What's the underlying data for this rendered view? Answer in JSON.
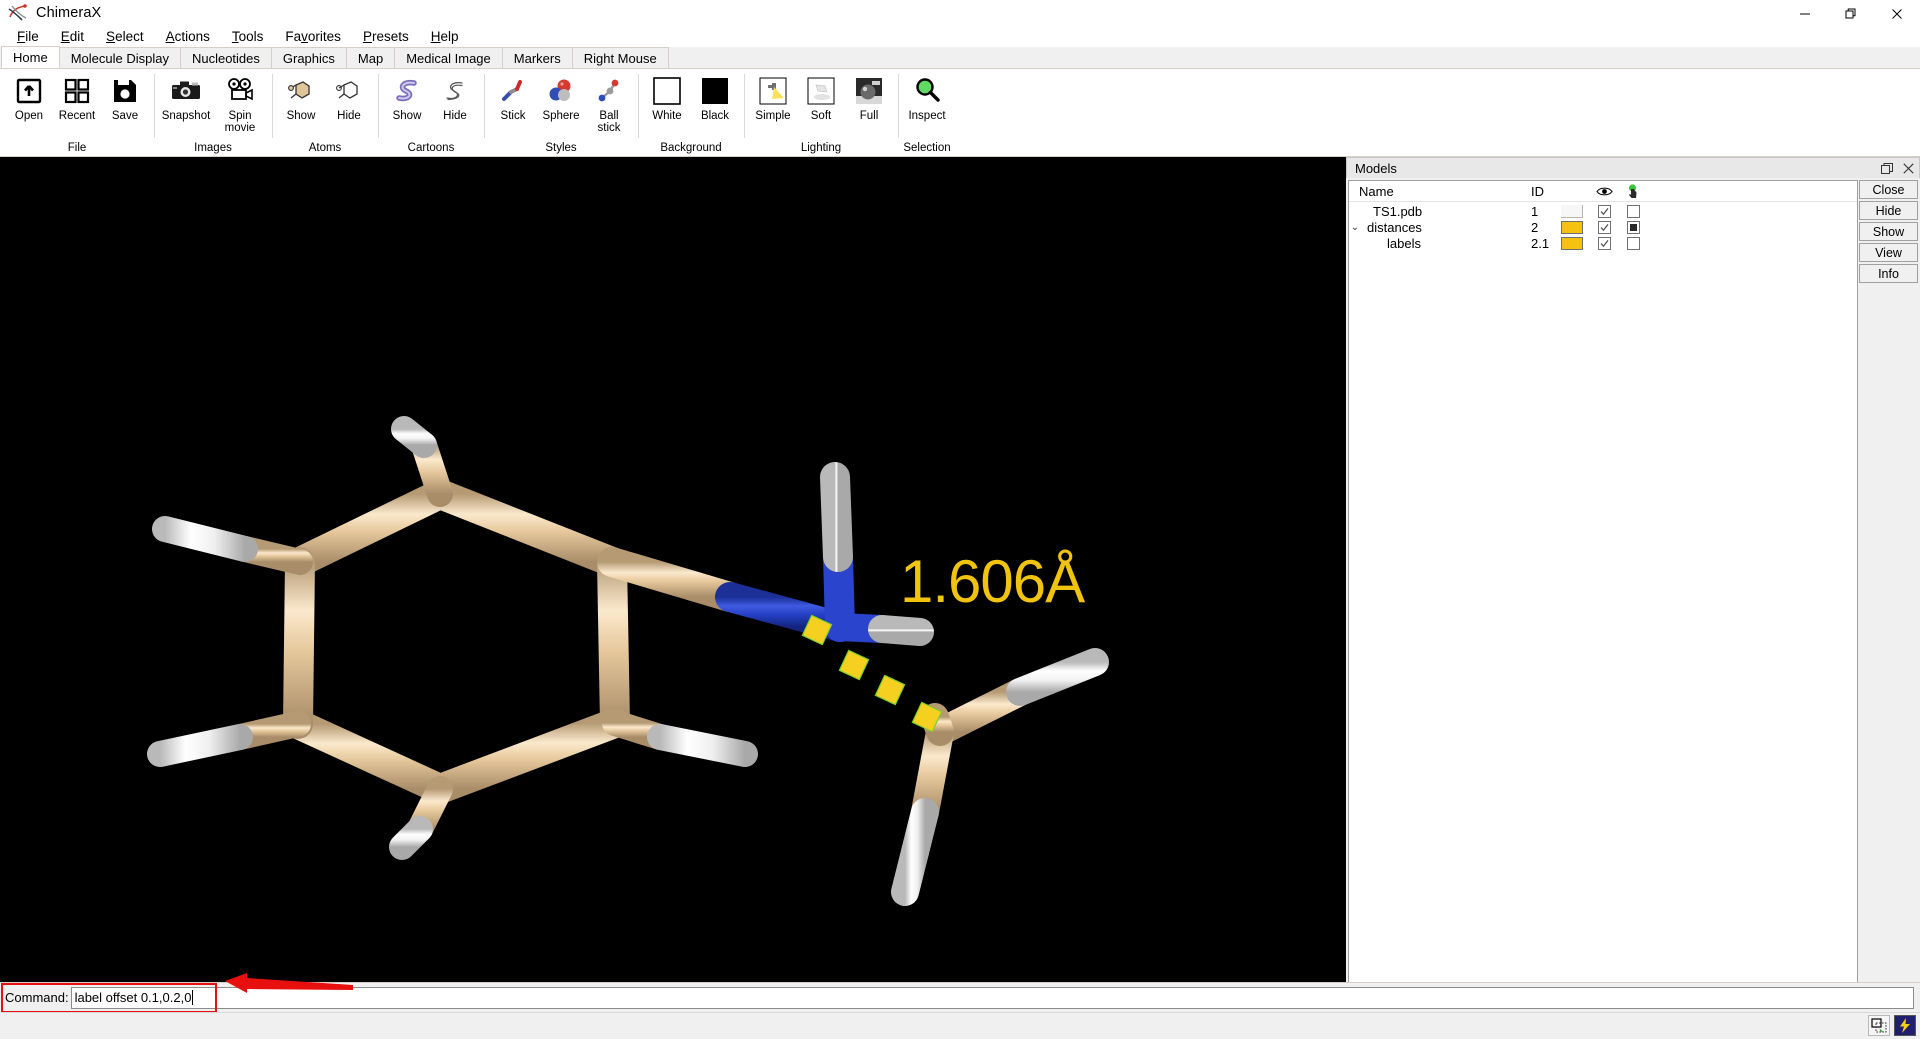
{
  "window": {
    "title": "ChimeraX",
    "app_icon": "chimerax-icon",
    "minimize": "–",
    "maximize": "❐",
    "close": "✕"
  },
  "menubar": {
    "items": [
      {
        "label": "File",
        "mnemonic": "F"
      },
      {
        "label": "Edit",
        "mnemonic": "E"
      },
      {
        "label": "Select",
        "mnemonic": "S"
      },
      {
        "label": "Actions",
        "mnemonic": "A"
      },
      {
        "label": "Tools",
        "mnemonic": "T"
      },
      {
        "label": "Favorites",
        "mnemonic": "v"
      },
      {
        "label": "Presets",
        "mnemonic": "P"
      },
      {
        "label": "Help",
        "mnemonic": "H"
      }
    ]
  },
  "tabs": [
    {
      "label": "Home",
      "active": true
    },
    {
      "label": "Molecule Display",
      "active": false
    },
    {
      "label": "Nucleotides",
      "active": false
    },
    {
      "label": "Graphics",
      "active": false
    },
    {
      "label": "Map",
      "active": false
    },
    {
      "label": "Medical Image",
      "active": false
    },
    {
      "label": "Markers",
      "active": false
    },
    {
      "label": "Right Mouse",
      "active": false
    }
  ],
  "ribbon": {
    "groups": [
      {
        "name": "File",
        "items": [
          {
            "label": "Open",
            "icon": "open-folder-icon"
          },
          {
            "label": "Recent",
            "icon": "recent-grid-icon"
          },
          {
            "label": "Save",
            "icon": "save-floppy-icon"
          }
        ]
      },
      {
        "name": "Images",
        "items": [
          {
            "label": "Snapshot",
            "icon": "camera-icon"
          },
          {
            "label": "Spin\nmovie",
            "icon": "movie-camera-icon"
          }
        ]
      },
      {
        "name": "Atoms",
        "items": [
          {
            "label": "Show",
            "icon": "atoms-show-icon"
          },
          {
            "label": "Hide",
            "icon": "atoms-hide-icon"
          }
        ]
      },
      {
        "name": "Cartoons",
        "items": [
          {
            "label": "Show",
            "icon": "cartoon-show-icon"
          },
          {
            "label": "Hide",
            "icon": "cartoon-hide-icon"
          }
        ]
      },
      {
        "name": "Styles",
        "items": [
          {
            "label": "Stick",
            "icon": "stick-style-icon"
          },
          {
            "label": "Sphere",
            "icon": "sphere-style-icon"
          },
          {
            "label": "Ball\nstick",
            "icon": "ballstick-style-icon"
          }
        ]
      },
      {
        "name": "Background",
        "items": [
          {
            "label": "White",
            "icon": "white-swatch-icon"
          },
          {
            "label": "Black",
            "icon": "black-swatch-icon"
          }
        ]
      },
      {
        "name": "Lighting",
        "items": [
          {
            "label": "Simple",
            "icon": "lighting-simple-icon"
          },
          {
            "label": "Soft",
            "icon": "lighting-soft-icon"
          },
          {
            "label": "Full",
            "icon": "lighting-full-icon"
          }
        ]
      },
      {
        "name": "Selection",
        "items": [
          {
            "label": "Inspect",
            "icon": "magnifier-inspect-icon"
          }
        ]
      }
    ]
  },
  "viewport": {
    "background_color": "#000000",
    "distance_label": "1.606Å",
    "label_color": "#f0c30f",
    "molecule": {
      "carbon_color": "#e0c49a",
      "hydrogen_color": "#ffffff",
      "nitrogen_color": "#2540c8",
      "distance_dash_color": "#f5d020"
    }
  },
  "models_panel": {
    "title": "Models",
    "float_icon": "float-panel-icon",
    "close_icon": "close-panel-icon",
    "columns": {
      "name": "Name",
      "id": "ID",
      "color": "",
      "shown": "eye-icon",
      "select": "select-hand-icon"
    },
    "rows": [
      {
        "name": "TS1.pdb",
        "id": "1",
        "indent": 1,
        "chevron": "",
        "color": "#f4f4f4",
        "shown": true,
        "selected": "none"
      },
      {
        "name": "distances",
        "id": "2",
        "indent": 0,
        "chevron": "⌄",
        "color": "#f5c211",
        "shown": true,
        "selected": "full"
      },
      {
        "name": "labels",
        "id": "2.1",
        "indent": 2,
        "chevron": "",
        "color": "#f5c211",
        "shown": true,
        "selected": "none"
      }
    ],
    "buttons": [
      {
        "label": "Close"
      },
      {
        "label": "Hide"
      },
      {
        "label": "Show"
      },
      {
        "label": "View"
      },
      {
        "label": "Info"
      }
    ]
  },
  "command_line": {
    "label": "Command:",
    "value": "label offset 0.1,0.2,0",
    "placeholder": "",
    "highlight_color": "#e8100e",
    "annotation": "red-arrow-annotation"
  },
  "status_bar": {
    "message": "",
    "icons": [
      {
        "name": "select-region-icon"
      },
      {
        "name": "lightning-icon"
      }
    ]
  }
}
